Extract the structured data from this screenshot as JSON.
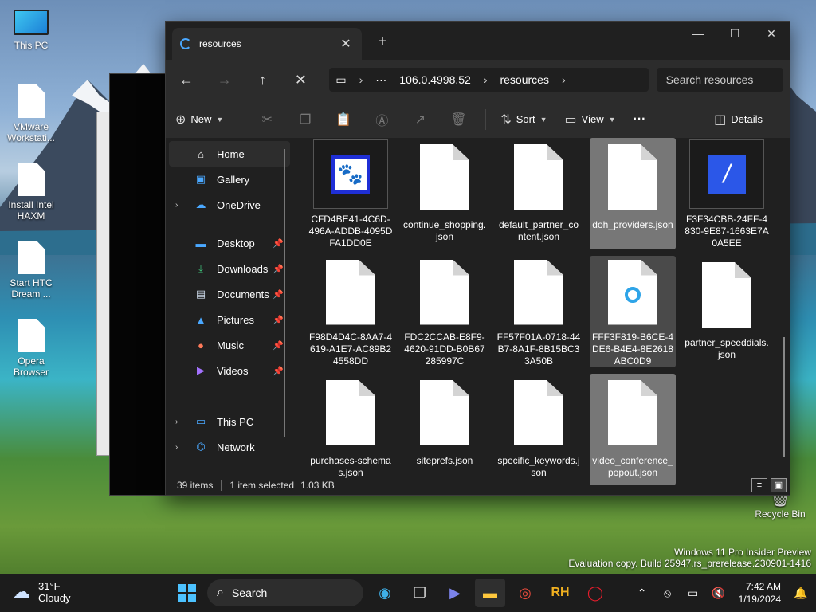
{
  "desktop": {
    "icons": [
      {
        "label": "This PC"
      },
      {
        "label": "VMware Workstati..."
      },
      {
        "label": "Install Intel HAXM"
      },
      {
        "label": "Start HTC Dream ..."
      },
      {
        "label": "Opera Browser"
      }
    ],
    "recycle_bin": "Recycle Bin",
    "watermark_line1": "Windows 11 Pro Insider Preview",
    "watermark_line2": "Evaluation copy. Build 25947.rs_prerelease.230901-1416"
  },
  "explorer": {
    "tab_title": "resources",
    "address": {
      "ellipsis": "···",
      "segment1": "106.0.4998.52",
      "segment2": "resources"
    },
    "search_placeholder": "Search resources",
    "commands": {
      "new": "New",
      "sort": "Sort",
      "view": "View",
      "more": "···",
      "details": "Details"
    },
    "sidebar": [
      {
        "label": "Home"
      },
      {
        "label": "Gallery"
      },
      {
        "label": "OneDrive"
      },
      {
        "label": "Desktop"
      },
      {
        "label": "Downloads"
      },
      {
        "label": "Documents"
      },
      {
        "label": "Pictures"
      },
      {
        "label": "Music"
      },
      {
        "label": "Videos"
      },
      {
        "label": "This PC"
      },
      {
        "label": "Network"
      }
    ],
    "files": [
      {
        "name": "CFD4BE41-4C6D-496A-ADDB-4095DFA1DD0E"
      },
      {
        "name": "continue_shopping.json"
      },
      {
        "name": "default_partner_content.json"
      },
      {
        "name": "doh_providers.json"
      },
      {
        "name": "F3F34CBB-24FF-4830-9E87-1663E7A0A5EE"
      },
      {
        "name": "F98D4D4C-8AA7-4619-A1E7-AC89B24558DD"
      },
      {
        "name": "FDC2CCAB-E8F9-4620-91DD-B0B67285997C"
      },
      {
        "name": "FF57F01A-0718-44B7-8A1F-8B15BC33A50B"
      },
      {
        "name": "FFF3F819-B6CE-4DE6-B4E4-8E2618ABC0D9"
      },
      {
        "name": "partner_speeddials.json"
      },
      {
        "name": "purchases-schemas.json"
      },
      {
        "name": "siteprefs.json"
      },
      {
        "name": "specific_keywords.json"
      },
      {
        "name": "video_conference_popout.json"
      }
    ],
    "status": {
      "count": "39 items",
      "selection": "1 item selected",
      "size": "1.03 KB"
    }
  },
  "taskbar": {
    "weather_temp": "31°F",
    "weather_desc": "Cloudy",
    "search_label": "Search",
    "time": "7:42 AM",
    "date": "1/19/2024"
  }
}
